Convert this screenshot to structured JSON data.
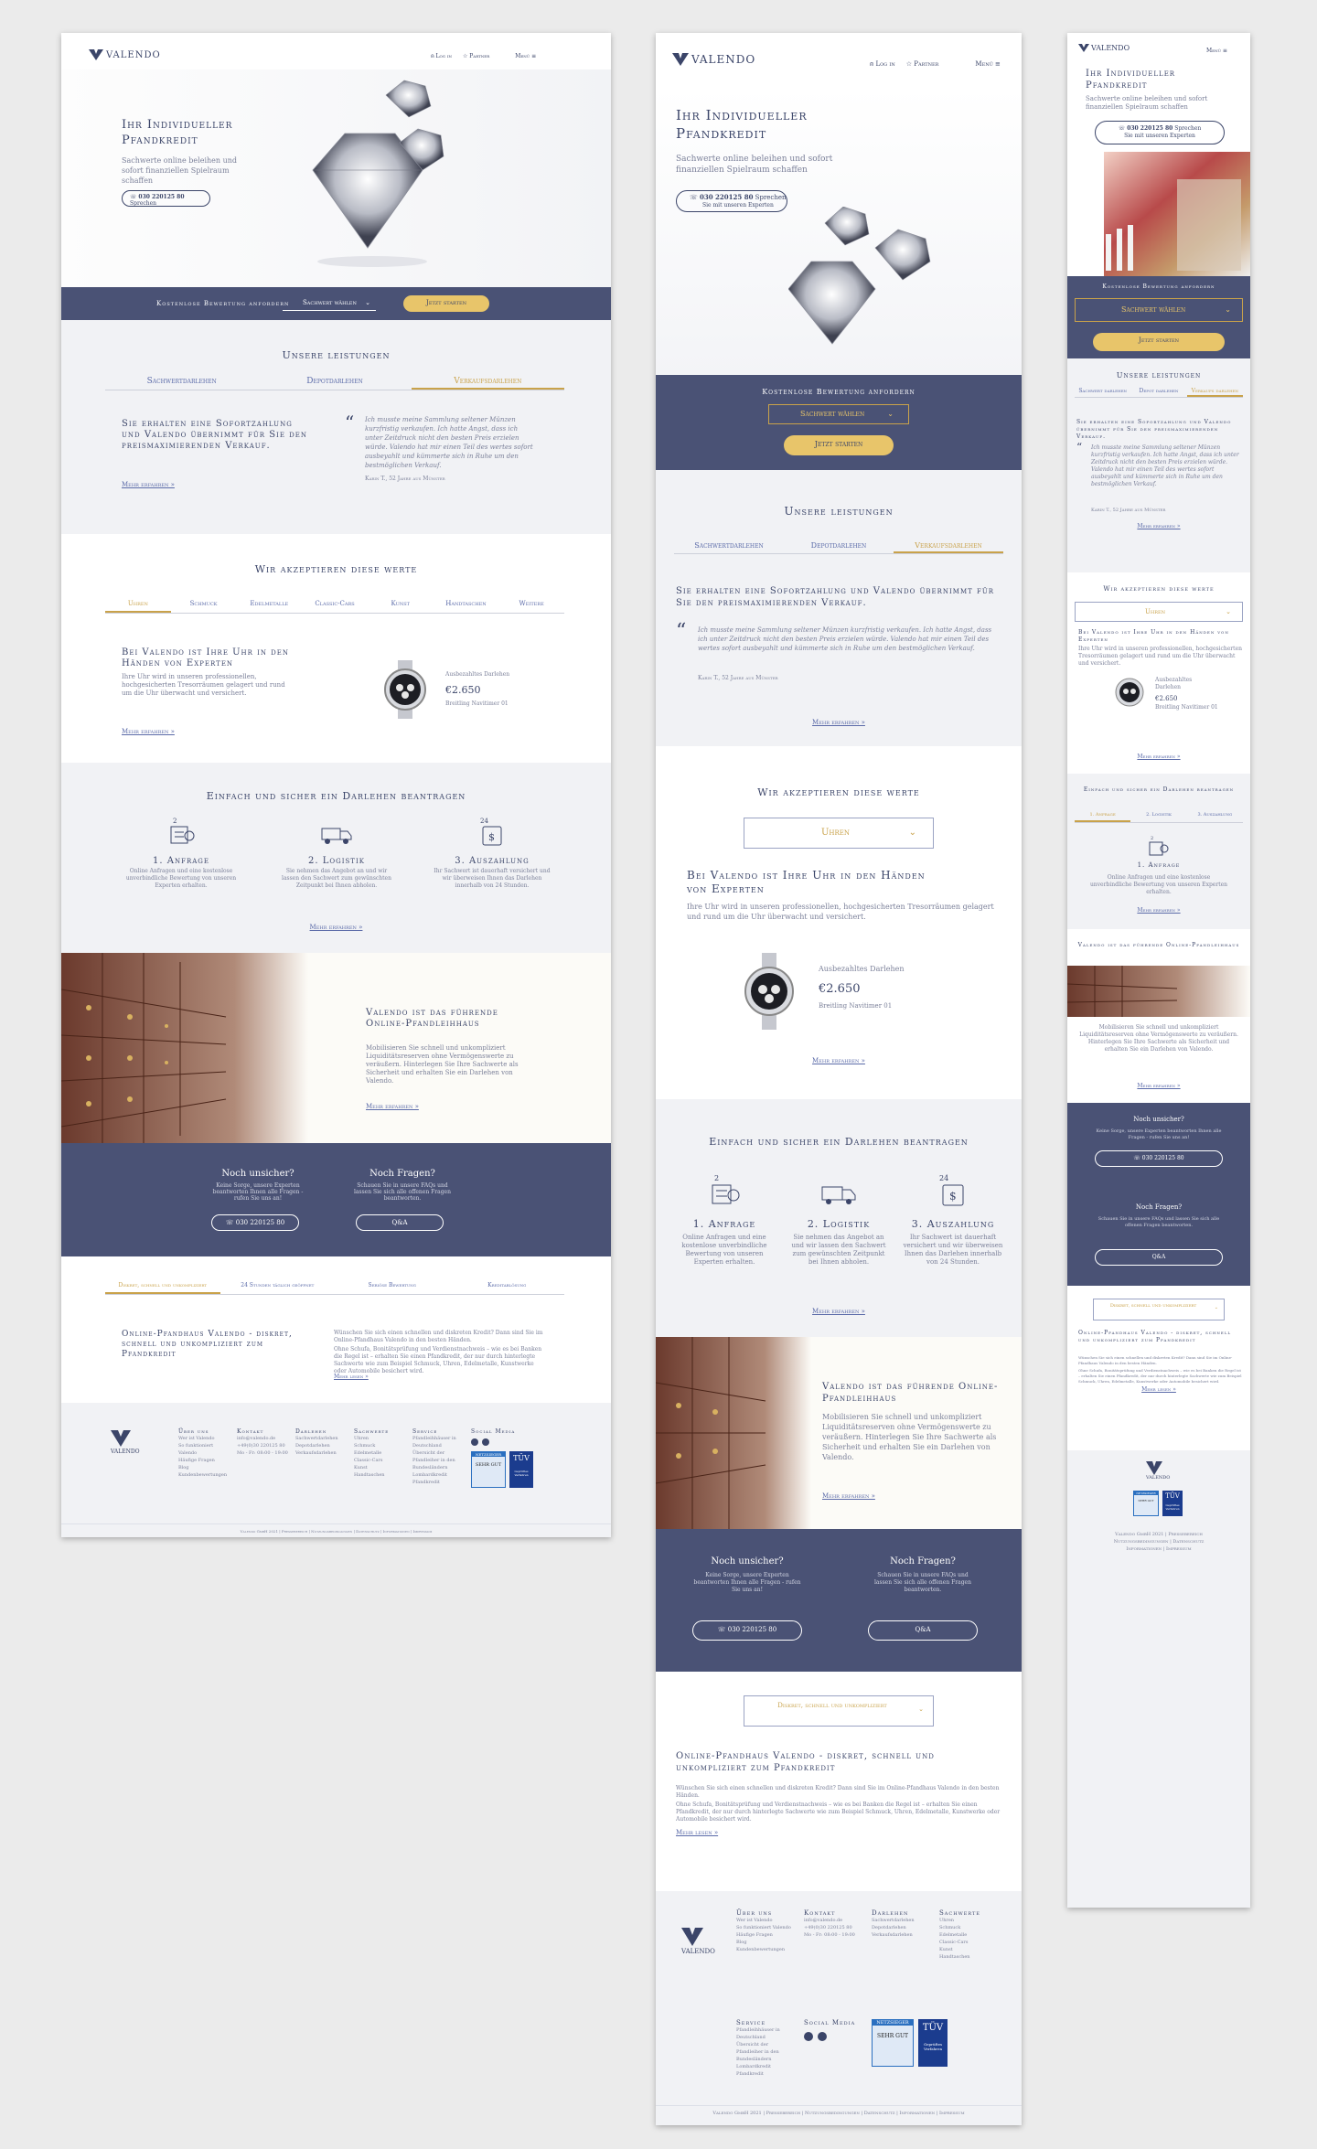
{
  "brand": {
    "name": "VALENDO"
  },
  "header": {
    "login": "Log in",
    "partner": "Partner",
    "menu": "Menü"
  },
  "hero": {
    "title_l1": "Ihr Individueller",
    "title_l2": "Pfandkredit",
    "subtitle": "Sachwerte online beleihen und sofort finanziellen Spielraum schaffen",
    "phone": "030 220125 80",
    "phone_suffix": "Sprechen",
    "phone_sub": "Sie mit unseren Experten"
  },
  "valuation": {
    "label": "Kostenlose Bewertung anfordern",
    "select": "Sachwert wählen",
    "start": "Jetzt starten"
  },
  "services": {
    "heading": "Unsere leistungen",
    "tabs": [
      "Sachwertdarlehen",
      "Depotdarlehen",
      "Verkaufsdarlehen"
    ],
    "mtabs": [
      "Sachwert darlehen",
      "Depot darlehen",
      "Verkaufs darlehen"
    ],
    "title": "Sie erhalten eine Sofortzahlung und Valendo übernimmt für Sie den preismaximierenden Verkauf.",
    "quote": "Ich musste meine Sammlung seltener Münzen kurzfristig verkaufen. Ich hatte Angst, dass ich unter Zeitdruck nicht den besten Preis erzielen würde. Valendo hat mir einen Teil des wertes sofort ausbeyahlt und kümmerte sich in Ruhe um den bestmöglichen Verkauf.",
    "author": "Karin T., 52 Jahre aus Münster",
    "more": "Mehr erfahren »"
  },
  "values": {
    "heading": "Wir akzeptieren diese werte",
    "tabs": [
      "Uhren",
      "Schmuck",
      "Edelmetalle",
      "Classic-Cars",
      "Kunst",
      "Handtaschen",
      "Weitere"
    ],
    "select": "Uhren",
    "title": "Bei Valendo ist Ihre Uhr in den Händen von Experten",
    "text": "Ihre Uhr wird in unseren professionellen, hochgesicherten Tresorräumen gelagert und rund um die Uhr überwacht und versichert.",
    "loan_label": "Ausbezahltes Darlehen",
    "loan_value": "€2.650",
    "watch": "Breitling Navitimer 01",
    "more": "Mehr erfahren »"
  },
  "steps": {
    "heading": "Einfach und sicher ein Darlehen beantragen",
    "mtabs": [
      "1. Anfrage",
      "2. Logistik",
      "3. Auszahlung"
    ],
    "items": [
      {
        "badge": "2mins",
        "title": "1. Anfrage",
        "text": "Online Anfragen und eine kostenlose unverbindliche Bewertung von unseren Experten erhalten."
      },
      {
        "badge": "",
        "title": "2. Logistik",
        "text": "Sie nehmen das Angebot an und wir lassen den Sachwert zum gewünschten Zeitpunkt bei Ihnen abholen."
      },
      {
        "badge": "24hr",
        "title": "3. Auszahlung",
        "text": "Ihr Sachwert ist dauerhaft versichert und wir überweisen Ihnen das Darlehen innerhalb von 24 Stunden."
      }
    ],
    "more": "Mehr erfahren »"
  },
  "leading": {
    "title": "Valendo ist das führende Online-Pfandleihhaus",
    "text": "Mobilisieren Sie schnell und unkompliziert Liquiditätsreserven ohne Vermögenswerte zu veräußern. Hinterlegen Sie Ihre Sachwerte als Sicherheit und erhalten Sie ein Darlehen von Valendo.",
    "more": "Mehr erfahren »"
  },
  "contact": {
    "unsure_title": "Noch unsicher?",
    "unsure_text": "Keine Sorge, unsere Experten beantworten Ihnen alle Fragen - rufen Sie uns an!",
    "phone": "030 220125 80",
    "questions_title": "Noch Fragen?",
    "questions_text": "Schauen Sie in unsere FAQs und lassen Sie sich alle offenen Fragen beantworten.",
    "qa": "Q&A"
  },
  "seo": {
    "tabs": [
      "Diskret, schnell und unkompliziert",
      "24 Stunden täglich geöffnet",
      "Seriöse Bewertung",
      "Kreditablösung"
    ],
    "title": "Online-Pfandhaus Valendo - diskret, schnell und unkompliziert zum Pfandkredit",
    "text1": "Wünschen Sie sich einen schnellen und diskreten Kredit? Dann sind Sie im Online-Pfandhaus Valendo in den besten Händen.",
    "text2": "Ohne Schufa, Bonitätsprüfung und Verdienstnachweis – wie es bei Banken die Regel ist – erhalten Sie einen Pfandkredit, der nur durch hinterlegte Sachwerte wie zum Beispiel Schmuck, Uhren, Edelmetalle, Kunstwerke oder Automobile besichert wird.",
    "more": "Mehr lesen »"
  },
  "footer": {
    "cols": [
      {
        "title": "Über uns",
        "items": [
          "Wer ist Valendo",
          "So funktioniert Valendo",
          "Häufige Fragen",
          "Blog",
          "Kundenbewertungen"
        ]
      },
      {
        "title": "Kontakt",
        "items": [
          "info@valendo.de",
          "+49(0)30 220125 80",
          "Mo - Fr: 08:00 - 19:00"
        ]
      },
      {
        "title": "Darlehen",
        "items": [
          "Sachwertdarlehen",
          "Depotdarlehen",
          "Verkaufsdarlehen"
        ]
      },
      {
        "title": "Sachwerte",
        "items": [
          "Uhren",
          "Schmuck",
          "Edelmetalle",
          "Classic-Cars",
          "Kunst",
          "Handtaschen"
        ]
      },
      {
        "title": "Service",
        "items": [
          "Pfandleihhäuser in Deutschland",
          "Übersicht der Pfandleiher in den Bundesländern",
          "Lombardkredit",
          "Pfandkredit"
        ]
      }
    ],
    "social": "Social Media",
    "badge1": "NETZSIEGER",
    "badge1b": "SEHR GUT",
    "badge2": "TÜV",
    "badge2b": "Geprüftes Verfahren",
    "legal": "Valendo GmbH 2021 | Pressebereich | Nutzungsbedingungen | Datenschutz | Informationen | Impressum",
    "legal_m1": "Valendo GmbH 2021 | Pressebereich",
    "legal_m2": "Nutzungsbedingungen | Datenschutz",
    "legal_m3": "Informationen | Impressum"
  }
}
